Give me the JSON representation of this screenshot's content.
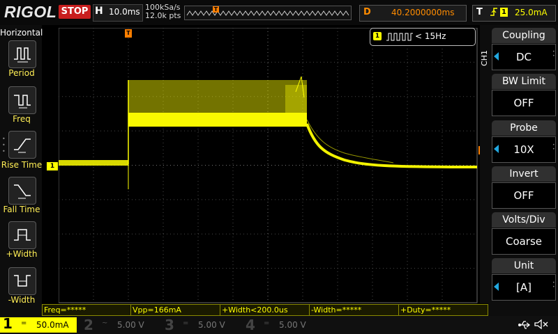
{
  "brand": "RIGOL",
  "run_state": "STOP",
  "timebase": {
    "letter": "H",
    "value": "10.0ms"
  },
  "sample": {
    "rate": "100kSa/s",
    "points": "12.0k pts"
  },
  "delay": {
    "letter": "D",
    "value": "40.2000000ms"
  },
  "trigger": {
    "letter": "T",
    "edge_icon": "rising-edge-icon",
    "source": "1",
    "level": "25.0mA"
  },
  "markers": {
    "ch1": "1",
    "trigger_level": "T",
    "trigger_position": "T"
  },
  "left_menu": {
    "title": "Horizontal",
    "items": [
      {
        "label": "Period",
        "icon": "period-icon"
      },
      {
        "label": "Freq",
        "icon": "freq-icon"
      },
      {
        "label": "Rise Time",
        "icon": "rise-time-icon"
      },
      {
        "label": "Fall Time",
        "icon": "fall-time-icon"
      },
      {
        "label": "+Width",
        "icon": "pos-width-icon"
      },
      {
        "label": "-Width",
        "icon": "neg-width-icon"
      }
    ]
  },
  "freq_counter": {
    "channel": "1",
    "text": "< 15Hz"
  },
  "right_menu": {
    "channel_label": "CH1",
    "items": [
      {
        "title": "Coupling",
        "value": "DC"
      },
      {
        "title": "BW Limit",
        "value": "OFF"
      },
      {
        "title": "Probe",
        "value": "10X"
      },
      {
        "title": "Invert",
        "value": "OFF"
      },
      {
        "title": "Volts/Div",
        "value": "Coarse"
      },
      {
        "title": "Unit",
        "value": "[A]"
      }
    ]
  },
  "measurements": [
    "Freq=*****",
    "Vpp=166mA",
    "+Width<200.0us",
    "-Width=*****",
    "+Duty=*****"
  ],
  "channels": [
    {
      "num": "1",
      "coupling": "=",
      "scale": "50.0mA",
      "active": true
    },
    {
      "num": "2",
      "coupling": "~",
      "scale": "5.00 V",
      "active": false
    },
    {
      "num": "3",
      "coupling": "=",
      "scale": "5.00 V",
      "active": false
    },
    {
      "num": "4",
      "coupling": "=",
      "scale": "5.00 V",
      "active": false
    }
  ],
  "colors": {
    "ch1": "#ffff00",
    "trigger": "#ff7f00",
    "stop": "#c81e1e",
    "accent": "#22a8e0"
  },
  "status_icons": [
    "usb-icon",
    "speaker-muted-icon"
  ]
}
